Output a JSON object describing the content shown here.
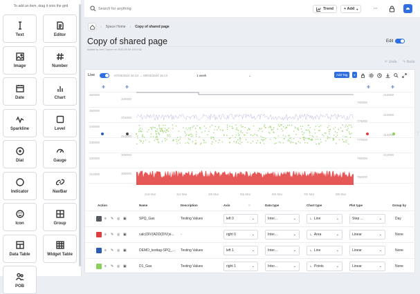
{
  "sidebar": {
    "hint": "To add an item, drag it onto the grid",
    "items": [
      {
        "label": "Text",
        "icon": "text-cursor-icon"
      },
      {
        "label": "Editor",
        "icon": "document-icon"
      },
      {
        "label": "Image",
        "icon": "image-icon"
      },
      {
        "label": "Number",
        "icon": "hash-icon"
      },
      {
        "label": "Date",
        "icon": "calendar-icon"
      },
      {
        "label": "Chart",
        "icon": "bar-chart-icon"
      },
      {
        "label": "Sparkline",
        "icon": "sparkline-icon"
      },
      {
        "label": "Level",
        "icon": "square-icon"
      },
      {
        "label": "Dial",
        "icon": "target-icon"
      },
      {
        "label": "Gauge",
        "icon": "gauge-icon"
      },
      {
        "label": "Indicator",
        "icon": "circle-icon"
      },
      {
        "label": "NavBar",
        "icon": "link-icon"
      },
      {
        "label": "Icon",
        "icon": "smiley-icon"
      },
      {
        "label": "Group",
        "icon": "grid-plus-icon"
      },
      {
        "label": "Data Table",
        "icon": "table-icon"
      },
      {
        "label": "Widget Table",
        "icon": "widget-table-icon"
      },
      {
        "label": "POB",
        "icon": "people-icon"
      }
    ]
  },
  "topbar": {
    "search_placeholder": "Search for anything",
    "trend_label": "Trend",
    "add_label": "+ Add",
    "more_label": "···"
  },
  "breadcrumb": {
    "parent": "Space Home",
    "current": "Copy of shared page"
  },
  "page": {
    "title": "Copy of shared page",
    "byline": "Added by Joel Charon on 2020-09-08 18:10:42",
    "edit_label": "Edit",
    "undo_label": "Undo",
    "redo_label": "Redo"
  },
  "trend": {
    "live_label": "Live",
    "date_range": "07/03/2024 16:13  →  08/03/2024 16:13",
    "range_label": "1 week",
    "add_tag_label": "Add Tag",
    "y_left_outer": [
      "360000",
      "350000",
      "340000",
      "330000",
      "320000",
      "310000"
    ],
    "y_left_inner": [
      "320000",
      "315000",
      "310000",
      "305000",
      "300000"
    ],
    "y_right_inner": [
      "780000",
      "775000",
      "770000",
      "765000",
      "760000"
    ],
    "y_right_outer": [
      "218000",
      "216000",
      "214000",
      "212000"
    ],
    "x_labels": [
      "2nd Mar",
      "3rd Mar",
      "4th Mar",
      "5th Mar",
      "6th Mar",
      "7th Mar",
      "8th Mar"
    ],
    "colors": {
      "gray": "#8a8f96",
      "red": "#e23b3b",
      "blue": "#2a5bb8",
      "green": "#8bd05a",
      "accent": "#2f6fe0"
    }
  },
  "table": {
    "headers": {
      "action": "Action",
      "name": "Name",
      "description": "Description",
      "axis": "Axis",
      "data_type": "Data type",
      "chart_type": "Chart type",
      "plot_type": "Plot type",
      "group_by": "Group by"
    },
    "rows": [
      {
        "color": "#555a60",
        "name": "SPQ_Gas",
        "description": "Testing Values",
        "axis": "left 0",
        "data_type": "Inter...",
        "chart_type": "Line",
        "plot_type": "Step ...",
        "group_by": "Day"
      },
      {
        "color": "#e23b3b",
        "name": "calc(DIV(ADD(DIV(si...",
        "description": "-",
        "axis": "right 0",
        "data_type": "Inter...",
        "chart_type": "Area",
        "plot_type": "Linear",
        "group_by": "None"
      },
      {
        "color": "#2a5bb8",
        "name": "DEMO_testtag-SPQ_...",
        "description": "Testing Values",
        "axis": "left 1",
        "data_type": "Inter...",
        "chart_type": "Line",
        "plot_type": "Linear",
        "group_by": "None"
      },
      {
        "color": "#8bd05a",
        "name": "D1_Gas",
        "description": "Testing Values",
        "axis": "right 1",
        "data_type": "Inter...",
        "chart_type": "Points",
        "plot_type": "Linear",
        "group_by": "None"
      }
    ]
  }
}
